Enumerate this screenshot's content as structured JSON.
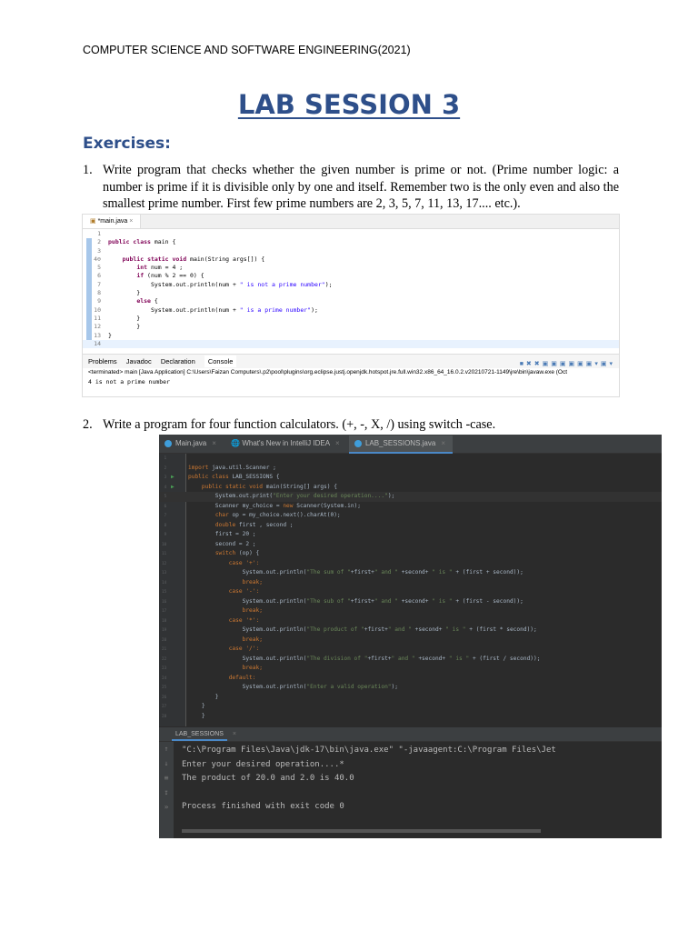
{
  "header": "COMPUTER SCIENCE AND SOFTWARE ENGINEERING(2021)",
  "title": "LAB SESSION 3",
  "section": "Exercises:",
  "items": [
    {
      "num": "1.",
      "text": "Write program that checks whether the given number is prime or not. (Prime number logic: a number is prime if it is divisible only by one and itself. Remember two is the only even and also the smallest prime number. First few prime numbers are 2, 3, 5, 7, 11, 13, 17.... etc.)."
    },
    {
      "num": "2.",
      "text": "Write a program for four function calculators. (+, -, X, /) using switch -case."
    }
  ],
  "eclipse": {
    "tab": "*main.java",
    "lines": [
      {
        "n": "1",
        "t": ""
      },
      {
        "n": "2",
        "t": "public class main {"
      },
      {
        "n": "3",
        "t": ""
      },
      {
        "n": "4⊖",
        "t": "    public static void main(String args[]) {"
      },
      {
        "n": "5",
        "t": "        int num = 4 ;"
      },
      {
        "n": "6",
        "t": "        if (num % 2 == 0) {"
      },
      {
        "n": "7",
        "t": "            System.out.println(num + \" is not a prime number\");"
      },
      {
        "n": "8",
        "t": "        }"
      },
      {
        "n": "9",
        "t": "        else {"
      },
      {
        "n": "10",
        "t": "            System.out.println(num + \" is a prime number\");"
      },
      {
        "n": "11",
        "t": "        }"
      },
      {
        "n": "12",
        "t": "        }"
      },
      {
        "n": "13",
        "t": "}"
      },
      {
        "n": "14",
        "t": ""
      }
    ],
    "views": [
      "Problems",
      "Javadoc",
      "Declaration",
      "Console"
    ],
    "terminated": "<terminated> main [Java Application] C:\\Users\\Faizan Computers\\.p2\\pool\\plugins\\org.eclipse.justj.openjdk.hotspot.jre.full.win32.x86_64_16.0.2.v20210721-1149\\jre\\bin\\javaw.exe  (Oct",
    "output": "4 is not a prime number"
  },
  "intellij": {
    "tabs": [
      "Main.java",
      "What's New in IntelliJ IDEA",
      "LAB_SESSIONS.java"
    ],
    "lines": [
      "",
      "import java.util.Scanner ;",
      "public class LAB_SESSIONS {",
      "    public static void main(String[] args) {",
      "        System.out.print(\"Enter your desired operation....\");",
      "        Scanner my_choice = new Scanner(System.in);",
      "        char op = my_choice.next().charAt(0);",
      "        double first , second ;",
      "        first = 20 ;",
      "        second = 2 ;",
      "        switch (op) {",
      "            case '+':",
      "                System.out.println(\"The sum of \"+first+\" and \" +second+ \" is \" + (first + second));",
      "                break;",
      "            case '-':",
      "                System.out.println(\"The sub of \"+first+\" and \" +second+ \" is \" + (first - second));",
      "                break;",
      "            case '*':",
      "                System.out.println(\"The product of \"+first+\" and \" +second+ \" is \" + (first * second));",
      "                break;",
      "            case '/':",
      "                System.out.println(\"The division of \"+first+\" and \" +second+ \" is \" + (first / second));",
      "                break;",
      "            default:",
      "                System.out.println(\"Enter a valid operation\");",
      "        }",
      "    }",
      "    }"
    ],
    "run_tab": "LAB_SESSIONS",
    "output": [
      "\"C:\\Program Files\\Java\\jdk-17\\bin\\java.exe\" \"-javaagent:C:\\Program Files\\Jet",
      "Enter your desired operation....*",
      "The product of 20.0 and 2.0 is 40.0",
      "",
      "Process finished with exit code 0"
    ]
  }
}
